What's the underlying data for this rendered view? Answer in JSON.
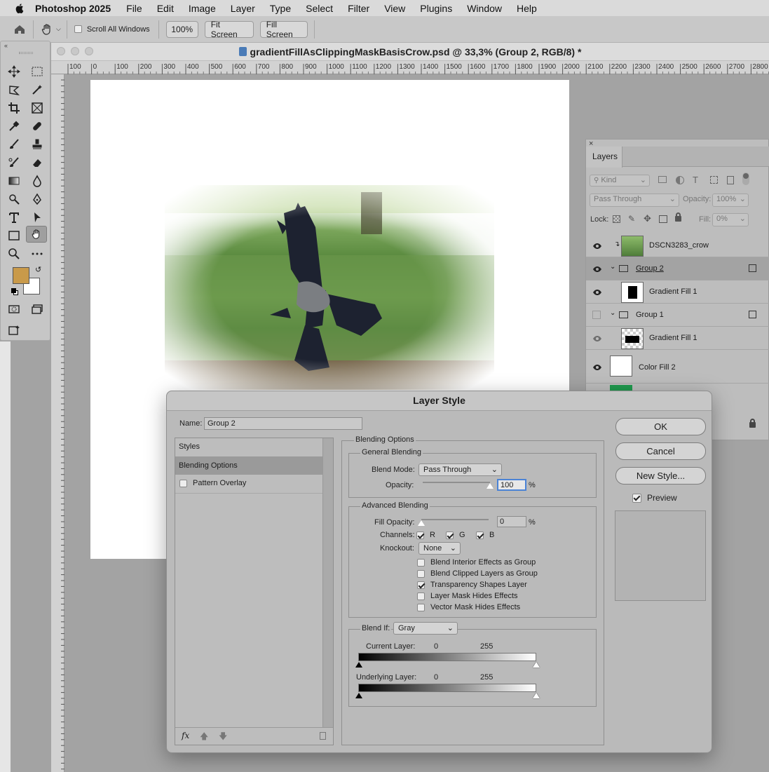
{
  "menubar": {
    "app_name": "Photoshop 2025",
    "items": [
      "File",
      "Edit",
      "Image",
      "Layer",
      "Type",
      "Select",
      "Filter",
      "View",
      "Plugins",
      "Window",
      "Help"
    ]
  },
  "options_bar": {
    "scroll_all_windows": "Scroll All Windows",
    "zoom_100": "100%",
    "fit_screen": "Fit Screen",
    "fill_screen": "Fill Screen"
  },
  "document": {
    "title": "gradientFillAsClippingMaskBasisCrow.psd @ 33,3% (Group 2, RGB/8) *",
    "ruler_ticks": [
      "100",
      "0",
      "100",
      "200",
      "300",
      "400",
      "500",
      "600",
      "700",
      "800",
      "900",
      "1000",
      "1100",
      "1200",
      "1300",
      "1400",
      "1500",
      "1600",
      "1700",
      "1800",
      "1900",
      "2000",
      "2100",
      "2200",
      "2300",
      "2400",
      "2500",
      "2600",
      "2700",
      "2800"
    ]
  },
  "colors": {
    "foreground": "#c99a4a",
    "background": "#ffffff",
    "color_fill_3": "#1f9a4e"
  },
  "layers_panel": {
    "tab": "Layers",
    "filter_kind": "Kind",
    "blend_mode": "Pass Through",
    "opacity_label": "Opacity:",
    "opacity_value": "100%",
    "lock_label": "Lock:",
    "fill_label": "Fill:",
    "fill_value": "0%",
    "layers": [
      {
        "name": "DSCN3283_crow",
        "visible": true
      },
      {
        "name": "Group 2",
        "visible": true,
        "selected": true
      },
      {
        "name": "Gradient Fill 1",
        "visible": true
      },
      {
        "name": "Group 1",
        "visible": false
      },
      {
        "name": "Gradient Fill 1",
        "visible": true
      },
      {
        "name": "Color Fill 2",
        "visible": true
      }
    ]
  },
  "dialog": {
    "title": "Layer Style",
    "name_label": "Name:",
    "name_value": "Group 2",
    "left_styles": "Styles",
    "left_blending_options": "Blending Options",
    "left_pattern_overlay": "Pattern Overlay",
    "section_title": "Blending Options",
    "general_blending": "General Blending",
    "blend_mode_label": "Blend Mode:",
    "blend_mode_value": "Pass Through",
    "opacity_label": "Opacity:",
    "opacity_value": "100",
    "opacity_level": 1.0,
    "percent": "%",
    "advanced_blending": "Advanced Blending",
    "fill_opacity_label": "Fill Opacity:",
    "fill_opacity_value": "0",
    "fill_opacity_level": 0.0,
    "channels_label": "Channels:",
    "channel_r": "R",
    "channel_g": "G",
    "channel_b": "B",
    "knockout_label": "Knockout:",
    "knockout_value": "None",
    "opt_blend_interior": "Blend Interior Effects as Group",
    "opt_blend_clipped": "Blend Clipped Layers as Group",
    "opt_transparency": "Transparency Shapes Layer",
    "opt_layer_mask": "Layer Mask Hides Effects",
    "opt_vector_mask": "Vector Mask Hides Effects",
    "blend_if_label": "Blend If:",
    "blend_if_value": "Gray",
    "current_layer_label": "Current Layer:",
    "underlying_layer_label": "Underlying Layer:",
    "range_low": "0",
    "range_high": "255",
    "ok": "OK",
    "cancel": "Cancel",
    "new_style": "New Style...",
    "preview": "Preview",
    "fx": "fx"
  }
}
